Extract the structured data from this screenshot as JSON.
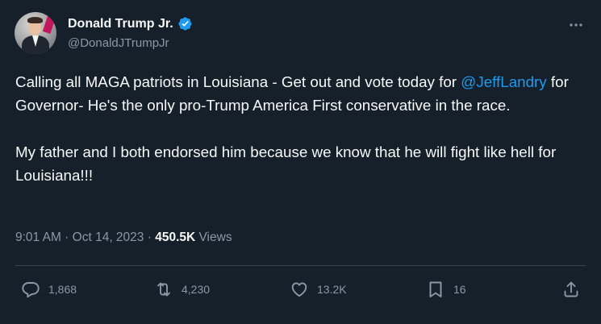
{
  "author": {
    "name": "Donald Trump Jr.",
    "handle": "@DonaldJTrumpJr"
  },
  "tweet": {
    "line1_before": "Calling all MAGA patriots in Louisiana - Get out and vote today for ",
    "mention": "@JeffLandry",
    "line1_after": " for Governor- He's the only pro-Trump America First conservative in the race.",
    "paragraph2": "My father and I both endorsed him because we know that he will fight like hell for Louisiana!!!"
  },
  "meta": {
    "time": "9:01 AM",
    "separator": " · ",
    "date": "Oct 14, 2023",
    "views_count": "450.5K",
    "views_label": "Views"
  },
  "actions": {
    "replies": "1,868",
    "retweets": "4,230",
    "likes": "13.2K",
    "bookmarks": "16"
  },
  "colors": {
    "background": "#15202b",
    "text": "#f7f9f9",
    "secondary": "#8b98a5",
    "accent": "#1d9bf0"
  },
  "icons": {
    "verified": "verified-badge-icon",
    "more": "more-dots-icon",
    "reply": "speech-bubble-icon",
    "retweet": "retweet-arrows-icon",
    "like": "heart-icon",
    "bookmark": "bookmark-icon",
    "share": "share-upload-icon"
  }
}
